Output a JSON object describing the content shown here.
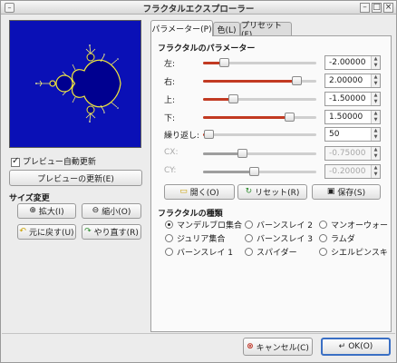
{
  "window": {
    "title": "フラクタルエクスプローラー"
  },
  "left": {
    "auto_update_label": "プレビュー自動更新",
    "auto_update_checked": true,
    "update_button": "プレビューの更新(E)",
    "size_section": "サイズ変更",
    "zoom_in": "拡大(I)",
    "zoom_out": "縮小(O)",
    "undo": "元に戻す(U)",
    "redo": "やり直す(R)"
  },
  "tabs": [
    {
      "label": "パラメーター(P)",
      "active": true
    },
    {
      "label": "色(L)",
      "active": false
    },
    {
      "label": "プリセット(F)",
      "active": false
    }
  ],
  "params_section": "フラクタルのパラメーター",
  "params": [
    {
      "label": "左:",
      "value": "-2.00000",
      "fraction": 0.18,
      "disabled": false
    },
    {
      "label": "右:",
      "value": "2.00000",
      "fraction": 0.82,
      "disabled": false
    },
    {
      "label": "上:",
      "value": "-1.50000",
      "fraction": 0.26,
      "disabled": false
    },
    {
      "label": "下:",
      "value": "1.50000",
      "fraction": 0.76,
      "disabled": false
    },
    {
      "label": "繰り返し:",
      "value": "50",
      "fraction": 0.05,
      "disabled": false
    },
    {
      "label": "CX:",
      "value": "-0.75000",
      "fraction": 0.34,
      "disabled": true
    },
    {
      "label": "CY:",
      "value": "-0.20000",
      "fraction": 0.45,
      "disabled": true
    }
  ],
  "actions": {
    "open": "開く(O)",
    "reset": "リセット(R)",
    "save": "保存(S)"
  },
  "types_section": "フラクタルの種類",
  "types": [
    {
      "label": "マンデルブロ集合",
      "selected": true
    },
    {
      "label": "バーンスレイ 2",
      "selected": false
    },
    {
      "label": "マンオーウォー",
      "selected": false
    },
    {
      "label": "ジュリア集合",
      "selected": false
    },
    {
      "label": "バーンスレイ 3",
      "selected": false
    },
    {
      "label": "ラムダ",
      "selected": false
    },
    {
      "label": "バーンスレイ 1",
      "selected": false
    },
    {
      "label": "スパイダー",
      "selected": false
    },
    {
      "label": "シエルピンスキ",
      "selected": false
    }
  ],
  "footer": {
    "cancel": "キャンセル(C)",
    "ok": "OK(O)"
  },
  "colors": {
    "preview_bg": "#0a10b6",
    "set_fill": "#0000a0",
    "edge": "#f2e83a",
    "slider_fill": "#c23a22"
  }
}
